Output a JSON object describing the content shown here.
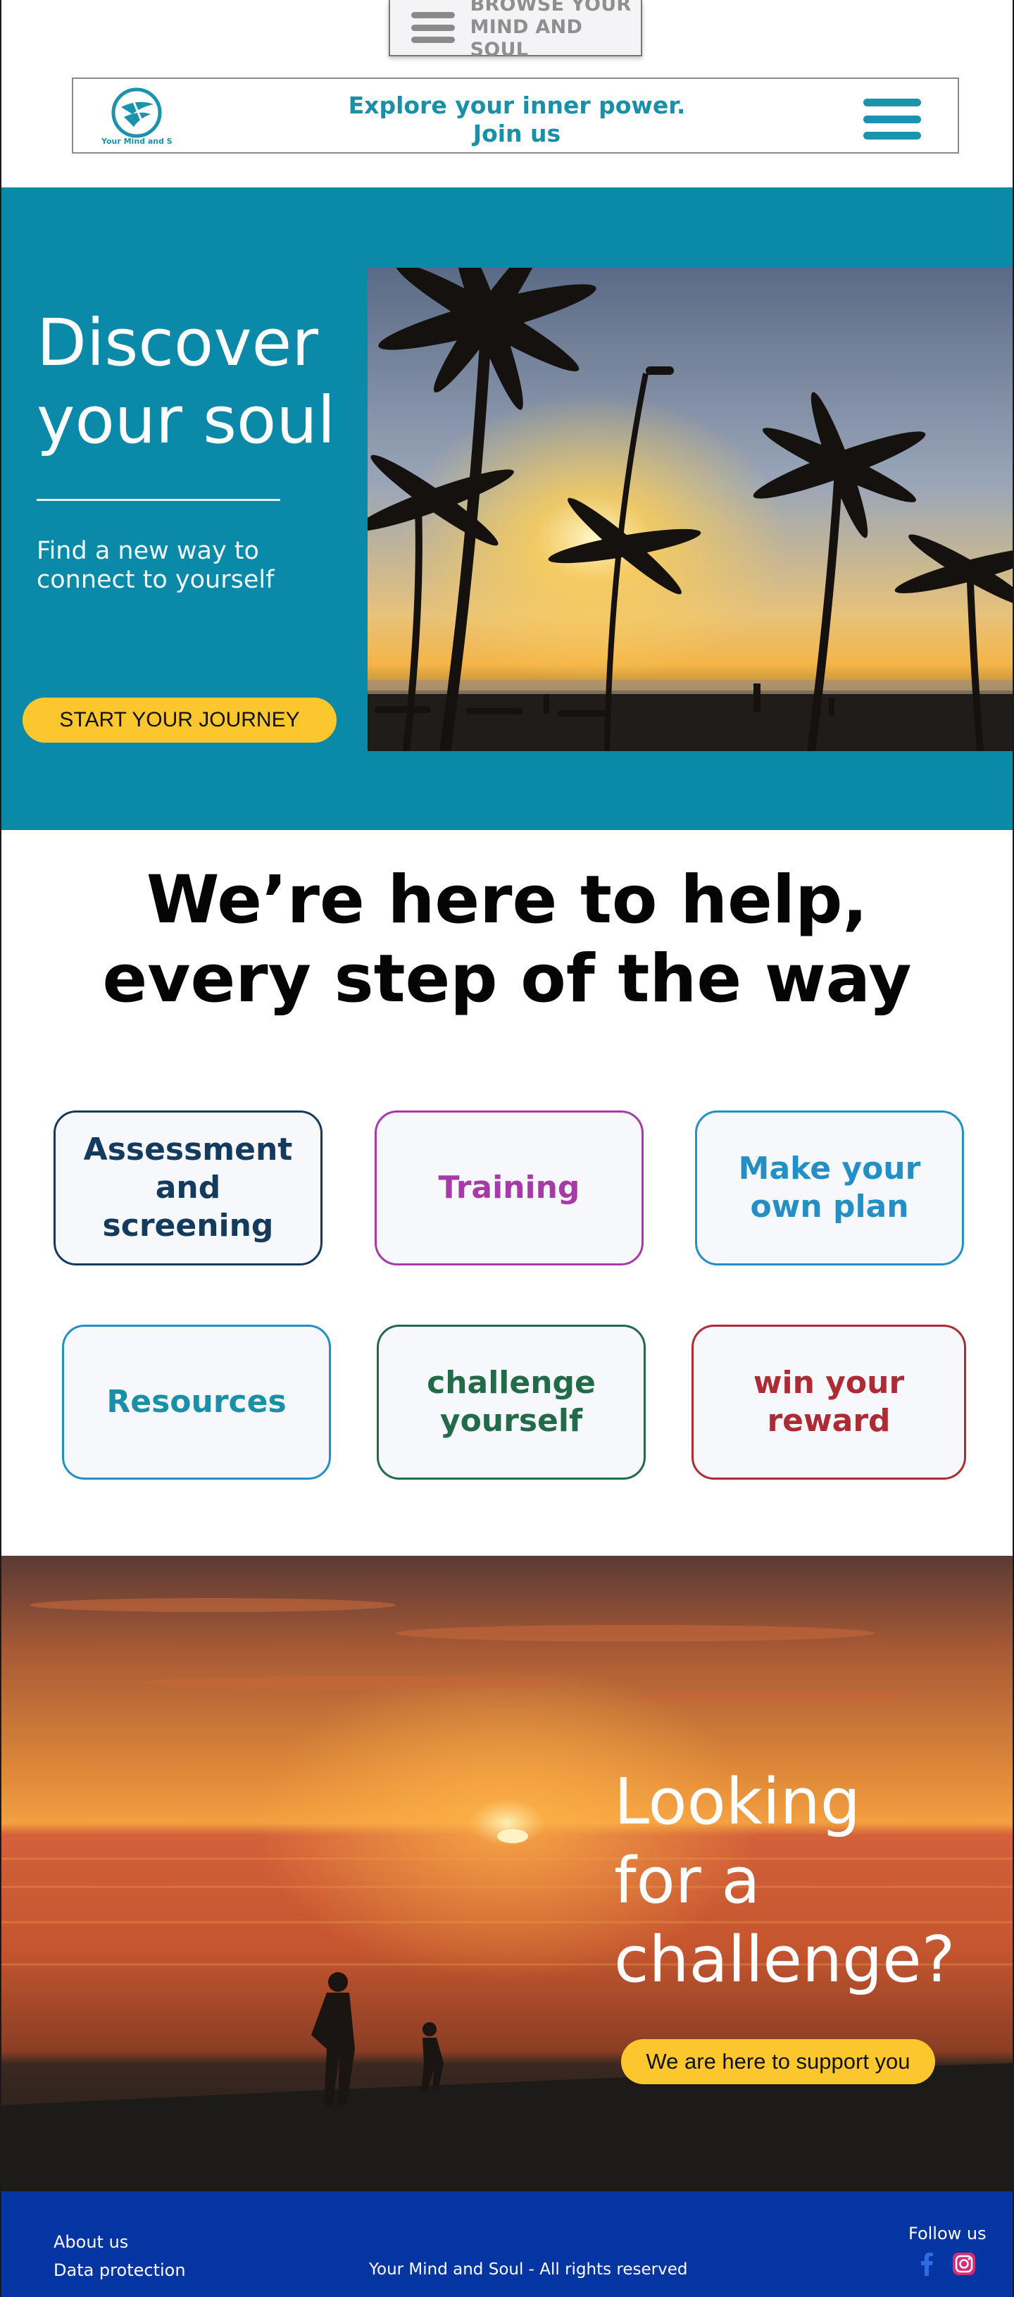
{
  "top_nav": {
    "browse_label": "BROWSE YOUR\nMIND AND SOUL",
    "menu_icon": "hamburger-icon"
  },
  "header": {
    "logo_text": "Your Mind and Soul",
    "tagline": "Explore your inner power.\nJoin us",
    "menu_icon": "hamburger-icon"
  },
  "hero": {
    "title": "Discover\nyour soul",
    "subtitle": "Find a new way to\nconnect to yourself",
    "cta": "START YOUR JOURNEY"
  },
  "help": {
    "title": "We’re here to help,\nevery step of the way",
    "cards": [
      {
        "label": "Assessment\nand\nscreening",
        "color": "#143a5e"
      },
      {
        "label": "Training",
        "color": "#a53aa8"
      },
      {
        "label": "Make your\nown plan",
        "color": "#2290c4"
      },
      {
        "label": "Resources",
        "color": "#1a8fa8"
      },
      {
        "label": "challenge\nyourself",
        "color": "#226b49"
      },
      {
        "label": "win your\nreward",
        "color": "#ae2b34"
      }
    ]
  },
  "challenge": {
    "title": "Looking\nfor a\nchallenge?",
    "cta": "We are here to support you"
  },
  "footer": {
    "about": "About us",
    "privacy": "Data protection",
    "copyright": "Your Mind and Soul - All rights reserved",
    "follow": "Follow us",
    "social": [
      "facebook-icon",
      "instagram-icon"
    ]
  },
  "colors": {
    "accent_teal": "#0a89a8",
    "cta_yellow": "#fbc72c",
    "footer_blue": "#0534a3"
  }
}
